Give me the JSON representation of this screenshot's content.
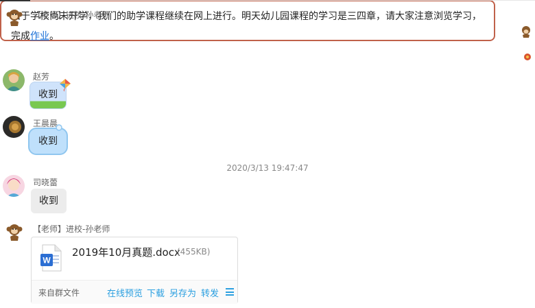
{
  "messages": [
    {
      "sender": "【老师】进校-孙老师",
      "text_before_link": "由于学校尚未开学，我们的助学课程继续在网上进行。明天幼儿园课程的学习是三四章，请大家注意浏览学习，完成",
      "link_text": "作业",
      "text_after_link": "。"
    },
    {
      "sender": "赵芳",
      "text": "收到"
    },
    {
      "sender": "王晨晨",
      "text": "收到"
    },
    {
      "timestamp": "2020/3/13 19:47:47"
    },
    {
      "sender": "司晓蕾",
      "text": "收到"
    },
    {
      "sender": "【老师】进校-孙老师",
      "file": {
        "icon": "word-doc-icon",
        "name": "2019年10月真题.docx",
        "size": "(455KB)",
        "source": "来自群文件",
        "actions": [
          "在线预览",
          "下载",
          "另存为",
          "转发"
        ]
      }
    }
  ],
  "colors": {
    "teacher_bubble_border": "#c0614a",
    "link": "#1a6fd6",
    "action": "#2a9fe0",
    "gray_bubble": "#ececec",
    "cloud_bubble": "#bfe0fb"
  }
}
